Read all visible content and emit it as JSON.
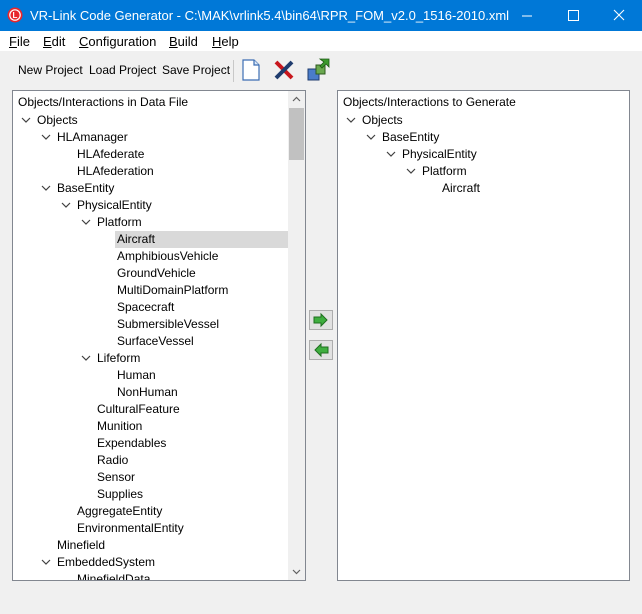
{
  "window": {
    "title": "VR-Link Code Generator - C:\\MAK\\vrlink5.4\\bin64\\RPR_FOM_v2.0_1516-2010.xml",
    "icon": "vrlink-app-icon",
    "controls": [
      "minimize-icon",
      "maximize-icon",
      "close-icon"
    ],
    "accent": "#0078d7"
  },
  "menu": [
    {
      "key": "F",
      "rest": "ile"
    },
    {
      "key": "E",
      "rest": "dit"
    },
    {
      "key": "C",
      "rest": "onfiguration"
    },
    {
      "key": "B",
      "rest": "uild"
    },
    {
      "key": "H",
      "rest": "elp"
    }
  ],
  "toolbar": {
    "new_project": "New Project",
    "load_project": "Load Project",
    "save_project": "Save Project",
    "icons": [
      "new-document-icon",
      "delete-x-icon",
      "generate-build-icon"
    ]
  },
  "left_panel": {
    "header": "Objects/Interactions in Data File",
    "items": [
      {
        "label": "Objects",
        "depth": 0,
        "expanded": true
      },
      {
        "label": "HLAmanager",
        "depth": 1,
        "expanded": true
      },
      {
        "label": "HLAfederate",
        "depth": 2,
        "leaf": true
      },
      {
        "label": "HLAfederation",
        "depth": 2,
        "leaf": true
      },
      {
        "label": "BaseEntity",
        "depth": 1,
        "expanded": true
      },
      {
        "label": "PhysicalEntity",
        "depth": 2,
        "expanded": true
      },
      {
        "label": "Platform",
        "depth": 3,
        "expanded": true
      },
      {
        "label": "Aircraft",
        "depth": 4,
        "leaf": true,
        "selected": true
      },
      {
        "label": "AmphibiousVehicle",
        "depth": 4,
        "leaf": true
      },
      {
        "label": "GroundVehicle",
        "depth": 4,
        "leaf": true
      },
      {
        "label": "MultiDomainPlatform",
        "depth": 4,
        "leaf": true
      },
      {
        "label": "Spacecraft",
        "depth": 4,
        "leaf": true
      },
      {
        "label": "SubmersibleVessel",
        "depth": 4,
        "leaf": true
      },
      {
        "label": "SurfaceVessel",
        "depth": 4,
        "leaf": true
      },
      {
        "label": "Lifeform",
        "depth": 3,
        "expanded": true
      },
      {
        "label": "Human",
        "depth": 4,
        "leaf": true
      },
      {
        "label": "NonHuman",
        "depth": 4,
        "leaf": true
      },
      {
        "label": "CulturalFeature",
        "depth": 3,
        "leaf": true
      },
      {
        "label": "Munition",
        "depth": 3,
        "leaf": true
      },
      {
        "label": "Expendables",
        "depth": 3,
        "leaf": true
      },
      {
        "label": "Radio",
        "depth": 3,
        "leaf": true
      },
      {
        "label": "Sensor",
        "depth": 3,
        "leaf": true
      },
      {
        "label": "Supplies",
        "depth": 3,
        "leaf": true
      },
      {
        "label": "AggregateEntity",
        "depth": 2,
        "leaf": true
      },
      {
        "label": "EnvironmentalEntity",
        "depth": 2,
        "leaf": true
      },
      {
        "label": "Minefield",
        "depth": 1,
        "leaf": true
      },
      {
        "label": "EmbeddedSystem",
        "depth": 1,
        "expanded": true
      },
      {
        "label": "MinefieldData",
        "depth": 2,
        "leaf": true
      }
    ]
  },
  "right_panel": {
    "header": "Objects/Interactions to Generate",
    "items": [
      {
        "label": "Objects",
        "depth": 0,
        "expanded": true
      },
      {
        "label": "BaseEntity",
        "depth": 1,
        "expanded": true
      },
      {
        "label": "PhysicalEntity",
        "depth": 2,
        "expanded": true
      },
      {
        "label": "Platform",
        "depth": 3,
        "expanded": true
      },
      {
        "label": "Aircraft",
        "depth": 4,
        "leaf": true
      }
    ]
  },
  "transfer": {
    "icons": [
      "add-right-arrow-icon",
      "remove-left-arrow-icon"
    ],
    "color": "#2ea02e"
  },
  "selection_color": "#d9d9d9"
}
